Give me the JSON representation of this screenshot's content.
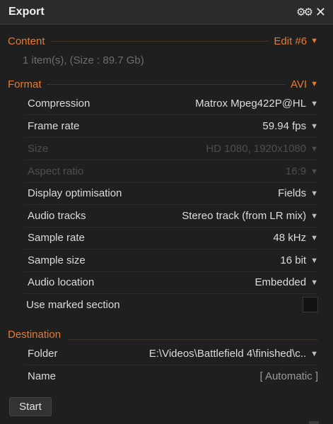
{
  "window": {
    "title": "Export"
  },
  "titlebar_icons": {
    "settings": "gears-icon",
    "close_glyph": "✕"
  },
  "content": {
    "heading": "Content",
    "value": "Edit #6",
    "info": "1 item(s), (Size : 89.7 Gb)"
  },
  "format": {
    "heading": "Format",
    "value": "AVI",
    "rows": [
      {
        "label": "Compression",
        "value": "Matrox Mpeg422P@HL"
      },
      {
        "label": "Frame rate",
        "value": "59.94 fps"
      },
      {
        "label": "Size",
        "value": "HD 1080, 1920x1080"
      },
      {
        "label": "Aspect ratio",
        "value": "16:9"
      },
      {
        "label": "Display optimisation",
        "value": "Fields"
      },
      {
        "label": "Audio tracks",
        "value": "Stereo track (from LR mix)"
      },
      {
        "label": "Sample rate",
        "value": "48 kHz"
      },
      {
        "label": "Sample size",
        "value": "16 bit"
      },
      {
        "label": "Audio location",
        "value": "Embedded"
      }
    ],
    "marked_section_label": "Use marked section"
  },
  "destination": {
    "heading": "Destination",
    "folder_label": "Folder",
    "folder_value": "E:\\Videos\\Battlefield 4\\finished\\c..",
    "name_label": "Name",
    "name_value": "[ Automatic ]"
  },
  "actions": {
    "start_label": "Start"
  },
  "colors": {
    "accent": "#e87a2d",
    "background": "#1f1f1f",
    "text": "#dcdcdc",
    "disabled": "#4e4e4e"
  }
}
